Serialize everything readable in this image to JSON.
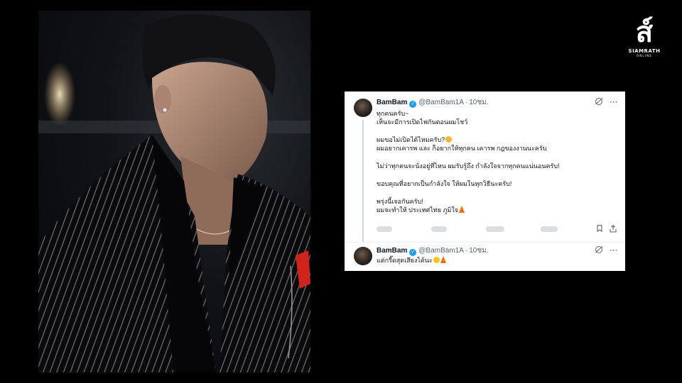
{
  "logo": {
    "mark": "ส์",
    "line1": "SIAMRATH",
    "line2": "ONLINE"
  },
  "photo": {
    "description_icon": "person-photo"
  },
  "tweets": [
    {
      "name": "BamBam",
      "handle": "@BamBam1A",
      "separator": "·",
      "time": "10ชม.",
      "lines": [
        "ทุกคนครับ~",
        "เห็นจะมีการเปิดไฟกันตอนผมโชว์",
        "",
        "ผมขอไม่เปิดได้ไหมครับ?",
        "ผมอยากเคารพ และ ก็อยากให้ทุกคน เคารพ กฎของงานนะครับ",
        "",
        "ไม่ว่าทุกคนจะนั่งอยู่ที่ไหน ผมรับรู้ถึง กำลังใจจากทุกคนแน่นอนครับ!",
        "",
        "ขอบคุณที่อยากเป็นกำลังใจ ให้ผมในทุกวิธีนะครับ!",
        "",
        "พรุ่งนี้เจอกันครับ!",
        "ผมจะทำให้ ประเทศไทย ภูมิใจ"
      ]
    },
    {
      "name": "BamBam",
      "handle": "@BamBam1A",
      "separator": "·",
      "time": "10ชม.",
      "lines": [
        "แต่กรี๊ดสุดเสียงได้นะ"
      ]
    }
  ],
  "icons": {
    "verified": "verified-badge-icon",
    "grok": "grok-icon",
    "more": "more-icon",
    "bookmark": "bookmark-icon",
    "share": "share-icon",
    "emoji_blush": "blush-emoji-icon",
    "emoji_fire": "fire-emoji-icon",
    "emoji_think": "thinking-emoji-icon"
  },
  "colors": {
    "verified": "#1d9bf0",
    "muted": "#536471",
    "text": "#0f1419",
    "card": "#ffffff",
    "background": "#000000"
  }
}
